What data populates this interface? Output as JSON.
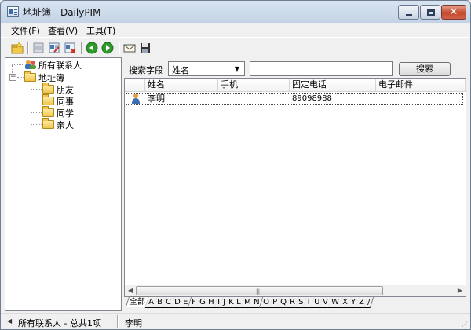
{
  "window": {
    "title": "地址簿 - DailyPIM"
  },
  "menu": {
    "items": [
      "文件(F)",
      "查看(V)",
      "工具(T)"
    ]
  },
  "toolbar": {
    "icons": [
      "new-contact-icon",
      "delete-icon",
      "edit-icon",
      "remove-icon",
      "back-icon",
      "forward-icon",
      "email-icon",
      "save-icon"
    ]
  },
  "tree": {
    "root": "所有联系人",
    "group": "地址簿",
    "children": [
      "朋友",
      "同事",
      "同学",
      "亲人"
    ]
  },
  "search": {
    "label": "搜索字段",
    "field": "姓名",
    "query": "",
    "button": "搜索"
  },
  "list": {
    "columns": [
      "姓名",
      "手机",
      "固定电话",
      "电子邮件"
    ],
    "rows": [
      {
        "name": "李明",
        "mobile": "",
        "phone": "89098988",
        "email": ""
      }
    ]
  },
  "alphabet": [
    "全部",
    "A",
    "B",
    "C",
    "D",
    "E",
    "F",
    "G",
    "H",
    "I",
    "J",
    "K",
    "L",
    "M",
    "N",
    "O",
    "P",
    "Q",
    "R",
    "S",
    "T",
    "U",
    "V",
    "W",
    "X",
    "Y",
    "Z",
    "/"
  ],
  "status": {
    "left": "所有联系人 - 总共1项",
    "right": "李明"
  },
  "colors": {
    "title_bg": "#c3d3e6",
    "close_button": "#c34a2d",
    "back_arrow": "#2e9a2a"
  }
}
